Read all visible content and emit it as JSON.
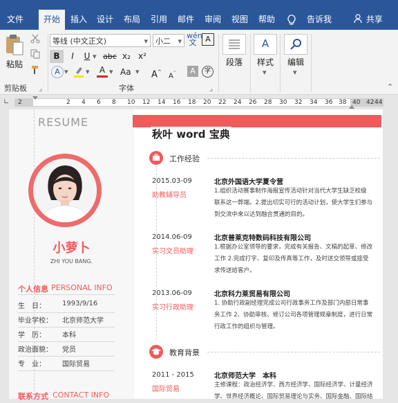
{
  "ribbon_tabs": [
    "文件",
    "开始",
    "插入",
    "设计",
    "布局",
    "引用",
    "邮件",
    "审阅",
    "视图",
    "帮助"
  ],
  "tell_me": "告诉我",
  "share": "共享",
  "clipboard": {
    "paste": "粘贴",
    "group": "剪贴板"
  },
  "font": {
    "name": "等线 (中文正文)",
    "size": "小二",
    "bold": "B",
    "italic": "I",
    "underline": "U",
    "strike": "abc",
    "subscript": "x₂",
    "superscript": "x²",
    "font_color": "A",
    "case": "Aa",
    "grow": "A",
    "shrink": "A",
    "group": "字体"
  },
  "paragraph": {
    "label": "段落"
  },
  "styles": {
    "label": "样式"
  },
  "editing": {
    "label": "编辑"
  },
  "ruler_ticks": [
    "2",
    "2",
    "4",
    "6",
    "8",
    "10",
    "12",
    "14",
    "16",
    "18",
    "20",
    "22",
    "24",
    "26",
    "28",
    "30",
    "32",
    "34",
    "36",
    "38",
    "40",
    "42",
    "44"
  ],
  "resume": {
    "watermark": "RESUME",
    "name": "小萝卜",
    "name_en": "ZHI YOU BANG.",
    "personal_title": "个人信息",
    "personal_title_en": "PERSONAL INFO",
    "personal": [
      {
        "label": "生　日：",
        "value": "1993/9/16"
      },
      {
        "label": "毕业学校：",
        "value": "北京师范大学"
      },
      {
        "label": "学　历：",
        "value": "本科"
      },
      {
        "label": "政治面貌：",
        "value": "党员"
      },
      {
        "label": "专　业：",
        "value": "国际贸易"
      }
    ],
    "contact_title": "联系方式",
    "contact_title_en": "CONTACT INFO",
    "doc_title": "秋叶 word 宝典",
    "work_title": "工作经验",
    "edu_title": "教育背景",
    "work": [
      {
        "date": "2015.03-09",
        "role": "助教辅导员",
        "company": "北京外国语大学夏令营",
        "lines": [
          "1.组织活动赛事制作海报宣传活动针对当代大学生缺乏校级",
          "联系这一弊端。2.提出切实可行的活动计划，使大学生们参与",
          "到交流中来以达到融合贯通的目的。"
        ]
      },
      {
        "date": "2014.06-09",
        "role": "实习文员助理",
        "company": "北京普莱克特数码科技有限公司",
        "lines": [
          "1.根据办公室领导的要求，完成有关报告、文稿的起草、修改",
          "工作 2.完成打字、复印及传真等工作，及时送交领导或接受",
          "求传送给客户。"
        ]
      },
      {
        "date": "2013.06-09",
        "role": "实习行政助理",
        "company": "北京科力莱贸易有限公司",
        "lines": [
          "1. 协助行政副经理完成公司行政事务工作及部门内部日常事",
          "务工作 2、协助审核、修订公司各项管理规章制度，进行日常",
          "行政工作的组织与管理。"
        ]
      }
    ],
    "education": {
      "date": "2011 - 2015",
      "role": "国际贸易",
      "school": "北京师范大学　本科",
      "lines": [
        "主修课程：政治经济学、西方经济学、国际经济学、计量经济",
        "学、世界经济概论、国际贸易理论与实务、国际金融、国际结"
      ]
    }
  },
  "colors": {
    "accent": "#ef5b5b",
    "ribbon": "#2b579a"
  }
}
